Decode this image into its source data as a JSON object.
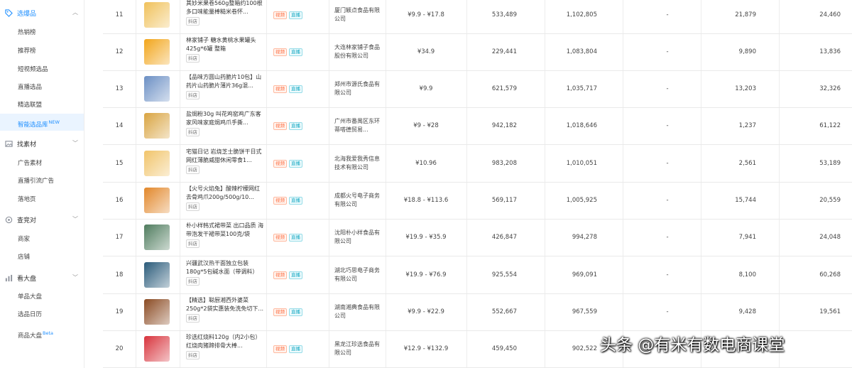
{
  "sidebar": {
    "sections": [
      {
        "label": "选爆品",
        "icon": "tag-icon",
        "chevron": "︿",
        "items": [
          {
            "label": "热销榜"
          },
          {
            "label": "推荐榜"
          },
          {
            "label": "短视频选品"
          },
          {
            "label": "直播选品"
          },
          {
            "label": "精选联盟"
          },
          {
            "label": "智能选品库",
            "badge": "NEW"
          }
        ]
      },
      {
        "label": "找素材",
        "icon": "image-icon",
        "chevron": "﹀",
        "items": [
          {
            "label": "广告素材"
          },
          {
            "label": "直播引流广告"
          },
          {
            "label": "落地页"
          }
        ]
      },
      {
        "label": "查竞对",
        "icon": "target-icon",
        "chevron": "﹀",
        "items": [
          {
            "label": "商家"
          },
          {
            "label": "店铺"
          }
        ]
      },
      {
        "label": "看大盘",
        "icon": "bar-chart-icon",
        "chevron": "﹀",
        "items": [
          {
            "label": "单品大盘"
          },
          {
            "label": "选品日历"
          },
          {
            "label": "商品大盘",
            "badge": "Beta"
          }
        ]
      }
    ]
  },
  "table": {
    "tag_video": "视频",
    "tag_live": "直播",
    "rows": [
      {
        "rank": "11",
        "title": "其妙米果卷560g整箱约100根多口味能量棒糙米卷怀...",
        "shop": "抖店",
        "company": "厦门颖点食品有限公司",
        "price": "¥9.9 - ¥17.8",
        "c1": "533,489",
        "c2": "1,102,805",
        "c3": "-",
        "c4": "21,879",
        "c5": "24,460",
        "thumb": "#f0c15a"
      },
      {
        "rank": "12",
        "title": "林家铺子 糖水黄桃水果罐头425g*6罐 整箱",
        "shop": "抖店",
        "company": "大连林家铺子食品股份有限公司",
        "price": "¥34.9",
        "c1": "229,441",
        "c2": "1,083,804",
        "c3": "-",
        "c4": "9,890",
        "c5": "13,836",
        "thumb": "#f2a51a"
      },
      {
        "rank": "13",
        "title": "【品味方圆山药脆片10包】山药片山药脆片薄片36g混...",
        "shop": "抖店",
        "company": "郑州市源氏食品有限公司",
        "price": "¥9.9",
        "c1": "621,579",
        "c2": "1,035,717",
        "c3": "-",
        "c4": "13,203",
        "c5": "32,326",
        "thumb": "#6b8fc4"
      },
      {
        "rank": "14",
        "title": "盐焗粉30g 叫花鸡窑鸡广东客家风味家庭焗鸡爪手撕...",
        "shop": "抖店",
        "company": "广州市番禺区东环蒂嗒德贸易...",
        "price": "¥9 - ¥28",
        "c1": "942,182",
        "c2": "1,018,646",
        "c3": "-",
        "c4": "1,237",
        "c5": "61,122",
        "thumb": "#d9a441"
      },
      {
        "rank": "15",
        "title": "宅猫日记 岩烧芝士脆饼干日式网红薄脆威甜休闲零食1...",
        "shop": "抖店",
        "company": "北海我爱我秀信息技术有限公司",
        "price": "¥10.96",
        "c1": "983,208",
        "c2": "1,010,051",
        "c3": "-",
        "c4": "2,561",
        "c5": "53,189",
        "thumb": "#f1c46a"
      },
      {
        "rank": "16",
        "title": "【火号火焰兔】酸辣柠檬网红去骨鸡爪200g/500g/10...",
        "shop": "抖店",
        "company": "成都火号电子商务有限公司",
        "price": "¥18.8 - ¥113.6",
        "c1": "569,117",
        "c2": "1,005,925",
        "c3": "-",
        "c4": "15,744",
        "c5": "20,559",
        "thumb": "#e2872a"
      },
      {
        "rank": "17",
        "title": "朴小样韩式裙带菜 出口品质 海带泡发干裙带菜100克/袋",
        "shop": "抖店",
        "company": "沈阳朴小样食品有限公司",
        "price": "¥19.9 - ¥35.9",
        "c1": "426,847",
        "c2": "994,278",
        "c3": "-",
        "c4": "7,941",
        "c5": "24,048",
        "thumb": "#4f7c5e"
      },
      {
        "rank": "18",
        "title": "兴疆武汉热干面独立包装180g*5包碱水面（带调料）",
        "shop": "抖店",
        "company": "湖北巧思电子商务有限公司",
        "price": "¥19.9 - ¥76.9",
        "c1": "925,554",
        "c2": "969,091",
        "c3": "-",
        "c4": "8,100",
        "c5": "60,268",
        "thumb": "#2a5b7a"
      },
      {
        "rank": "19",
        "title": "【精选】聪厨湘西外婆菜250g*2袋实惠装免洗免切下...",
        "shop": "抖店",
        "company": "湖南湘典食品有限公司",
        "price": "¥9.9 - ¥22.9",
        "c1": "552,667",
        "c2": "967,559",
        "c3": "-",
        "c4": "9,428",
        "c5": "19,561",
        "thumb": "#8a4a22"
      },
      {
        "rank": "20",
        "title": "珍选红烧料120g（内2小包）红烧肉猪蹄排骨大棒...",
        "shop": "抖店",
        "company": "黑龙江珍选食品有限公司",
        "price": "¥12.9 - ¥132.9",
        "c1": "459,450",
        "c2": "902,522",
        "c3": "-",
        "c4": "",
        "c5": "",
        "thumb": "#d8333c"
      }
    ]
  },
  "watermark": "头条 @有米有数电商课堂"
}
